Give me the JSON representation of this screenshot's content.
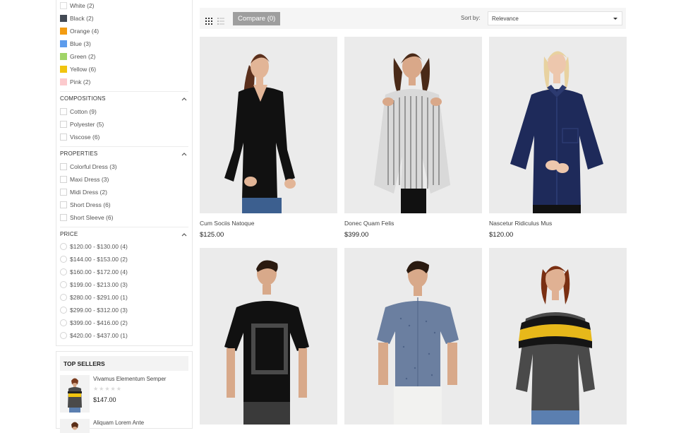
{
  "filters": {
    "colors": [
      {
        "label": "White",
        "count": "(2)",
        "swatch": "#ffffff"
      },
      {
        "label": "Black",
        "count": "(2)",
        "swatch": "#434a54"
      },
      {
        "label": "Orange",
        "count": "(4)",
        "swatch": "#f39c11"
      },
      {
        "label": "Blue",
        "count": "(3)",
        "swatch": "#5d9cec"
      },
      {
        "label": "Green",
        "count": "(2)",
        "swatch": "#a0d468"
      },
      {
        "label": "Yellow",
        "count": "(6)",
        "swatch": "#f1c40f"
      },
      {
        "label": "Pink",
        "count": "(2)",
        "swatch": "#fccacd"
      }
    ],
    "compositions": {
      "title": "COMPOSITIONS",
      "items": [
        {
          "label": "Cotton",
          "count": "(9)"
        },
        {
          "label": "Polyester",
          "count": "(5)"
        },
        {
          "label": "Viscose",
          "count": "(6)"
        }
      ]
    },
    "properties": {
      "title": "PROPERTIES",
      "items": [
        {
          "label": "Colorful Dress",
          "count": "(3)"
        },
        {
          "label": "Maxi Dress",
          "count": "(3)"
        },
        {
          "label": "Midi Dress",
          "count": "(2)"
        },
        {
          "label": "Short Dress",
          "count": "(6)"
        },
        {
          "label": "Short Sleeve",
          "count": "(6)"
        }
      ]
    },
    "price": {
      "title": "PRICE",
      "items": [
        {
          "label": "$120.00 - $130.00",
          "count": "(4)"
        },
        {
          "label": "$144.00 - $153.00",
          "count": "(2)"
        },
        {
          "label": "$160.00 - $172.00",
          "count": "(4)"
        },
        {
          "label": "$199.00 - $213.00",
          "count": "(3)"
        },
        {
          "label": "$280.00 - $291.00",
          "count": "(1)"
        },
        {
          "label": "$299.00 - $312.00",
          "count": "(3)"
        },
        {
          "label": "$399.00 - $416.00",
          "count": "(2)"
        },
        {
          "label": "$420.00 - $437.00",
          "count": "(1)"
        }
      ]
    }
  },
  "top_sellers": {
    "title": "TOP SELLERS",
    "items": [
      {
        "name": "Vivamus Elementum Semper",
        "price": "$147.00",
        "stars": "★★★★★"
      },
      {
        "name": "Aliquam Lorem Ante",
        "price": "",
        "stars": ""
      }
    ]
  },
  "toolbar": {
    "compare_label": "Compare (0)",
    "sort_label": "Sort by:",
    "sort_value": "Relevance",
    "grid_icon": "grid-view-icon",
    "list_icon": "list-view-icon"
  },
  "products": [
    {
      "name": "Cum Sociis Natoque",
      "price": "$125.00"
    },
    {
      "name": "Donec Quam Felis",
      "price": "$399.00"
    },
    {
      "name": "Nascetur Ridiculus Mus",
      "price": "$120.00"
    },
    {
      "name": "",
      "price": ""
    },
    {
      "name": "",
      "price": ""
    },
    {
      "name": "",
      "price": ""
    }
  ],
  "colors": {
    "compare_bg": "#9e9e9e",
    "image_bg": "#ebebeb",
    "toolbar_bg": "#f5f5f5"
  }
}
